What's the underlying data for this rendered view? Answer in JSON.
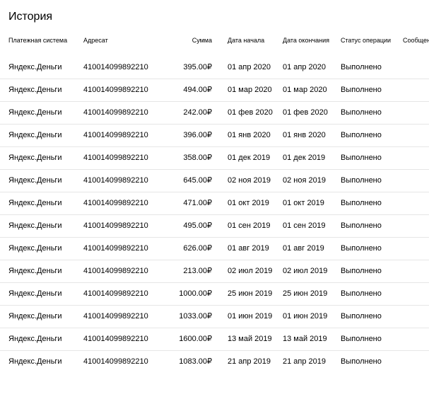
{
  "title": "История",
  "columns": {
    "system": "Платежная система",
    "recipient": "Адресат",
    "sum": "Сумма",
    "start": "Дата начала",
    "end": "Дата окончания",
    "status": "Статус операции",
    "message": "Сообщение"
  },
  "rows": [
    {
      "system": "Яндекс.Деньги",
      "recipient": "410014099892210",
      "sum": "395.00₽",
      "start": "01 апр 2020",
      "end": "01 апр 2020",
      "status": "Выполнено",
      "message": ""
    },
    {
      "system": "Яндекс.Деньги",
      "recipient": "410014099892210",
      "sum": "494.00₽",
      "start": "01 мар 2020",
      "end": "01 мар 2020",
      "status": "Выполнено",
      "message": ""
    },
    {
      "system": "Яндекс.Деньги",
      "recipient": "410014099892210",
      "sum": "242.00₽",
      "start": "01 фев 2020",
      "end": "01 фев 2020",
      "status": "Выполнено",
      "message": ""
    },
    {
      "system": "Яндекс.Деньги",
      "recipient": "410014099892210",
      "sum": "396.00₽",
      "start": "01 янв 2020",
      "end": "01 янв 2020",
      "status": "Выполнено",
      "message": ""
    },
    {
      "system": "Яндекс.Деньги",
      "recipient": "410014099892210",
      "sum": "358.00₽",
      "start": "01 дек 2019",
      "end": "01 дек 2019",
      "status": "Выполнено",
      "message": ""
    },
    {
      "system": "Яндекс.Деньги",
      "recipient": "410014099892210",
      "sum": "645.00₽",
      "start": "02 ноя 2019",
      "end": "02 ноя 2019",
      "status": "Выполнено",
      "message": ""
    },
    {
      "system": "Яндекс.Деньги",
      "recipient": "410014099892210",
      "sum": "471.00₽",
      "start": "01 окт 2019",
      "end": "01 окт 2019",
      "status": "Выполнено",
      "message": ""
    },
    {
      "system": "Яндекс.Деньги",
      "recipient": "410014099892210",
      "sum": "495.00₽",
      "start": "01 сен 2019",
      "end": "01 сен 2019",
      "status": "Выполнено",
      "message": ""
    },
    {
      "system": "Яндекс.Деньги",
      "recipient": "410014099892210",
      "sum": "626.00₽",
      "start": "01 авг 2019",
      "end": "01 авг 2019",
      "status": "Выполнено",
      "message": ""
    },
    {
      "system": "Яндекс.Деньги",
      "recipient": "410014099892210",
      "sum": "213.00₽",
      "start": "02 июл 2019",
      "end": "02 июл 2019",
      "status": "Выполнено",
      "message": ""
    },
    {
      "system": "Яндекс.Деньги",
      "recipient": "410014099892210",
      "sum": "1000.00₽",
      "start": "25 июн 2019",
      "end": "25 июн 2019",
      "status": "Выполнено",
      "message": ""
    },
    {
      "system": "Яндекс.Деньги",
      "recipient": "410014099892210",
      "sum": "1033.00₽",
      "start": "01 июн 2019",
      "end": "01 июн 2019",
      "status": "Выполнено",
      "message": ""
    },
    {
      "system": "Яндекс.Деньги",
      "recipient": "410014099892210",
      "sum": "1600.00₽",
      "start": "13 май 2019",
      "end": "13 май 2019",
      "status": "Выполнено",
      "message": ""
    },
    {
      "system": "Яндекс.Деньги",
      "recipient": "410014099892210",
      "sum": "1083.00₽",
      "start": "21 апр 2019",
      "end": "21 апр 2019",
      "status": "Выполнено",
      "message": ""
    }
  ]
}
